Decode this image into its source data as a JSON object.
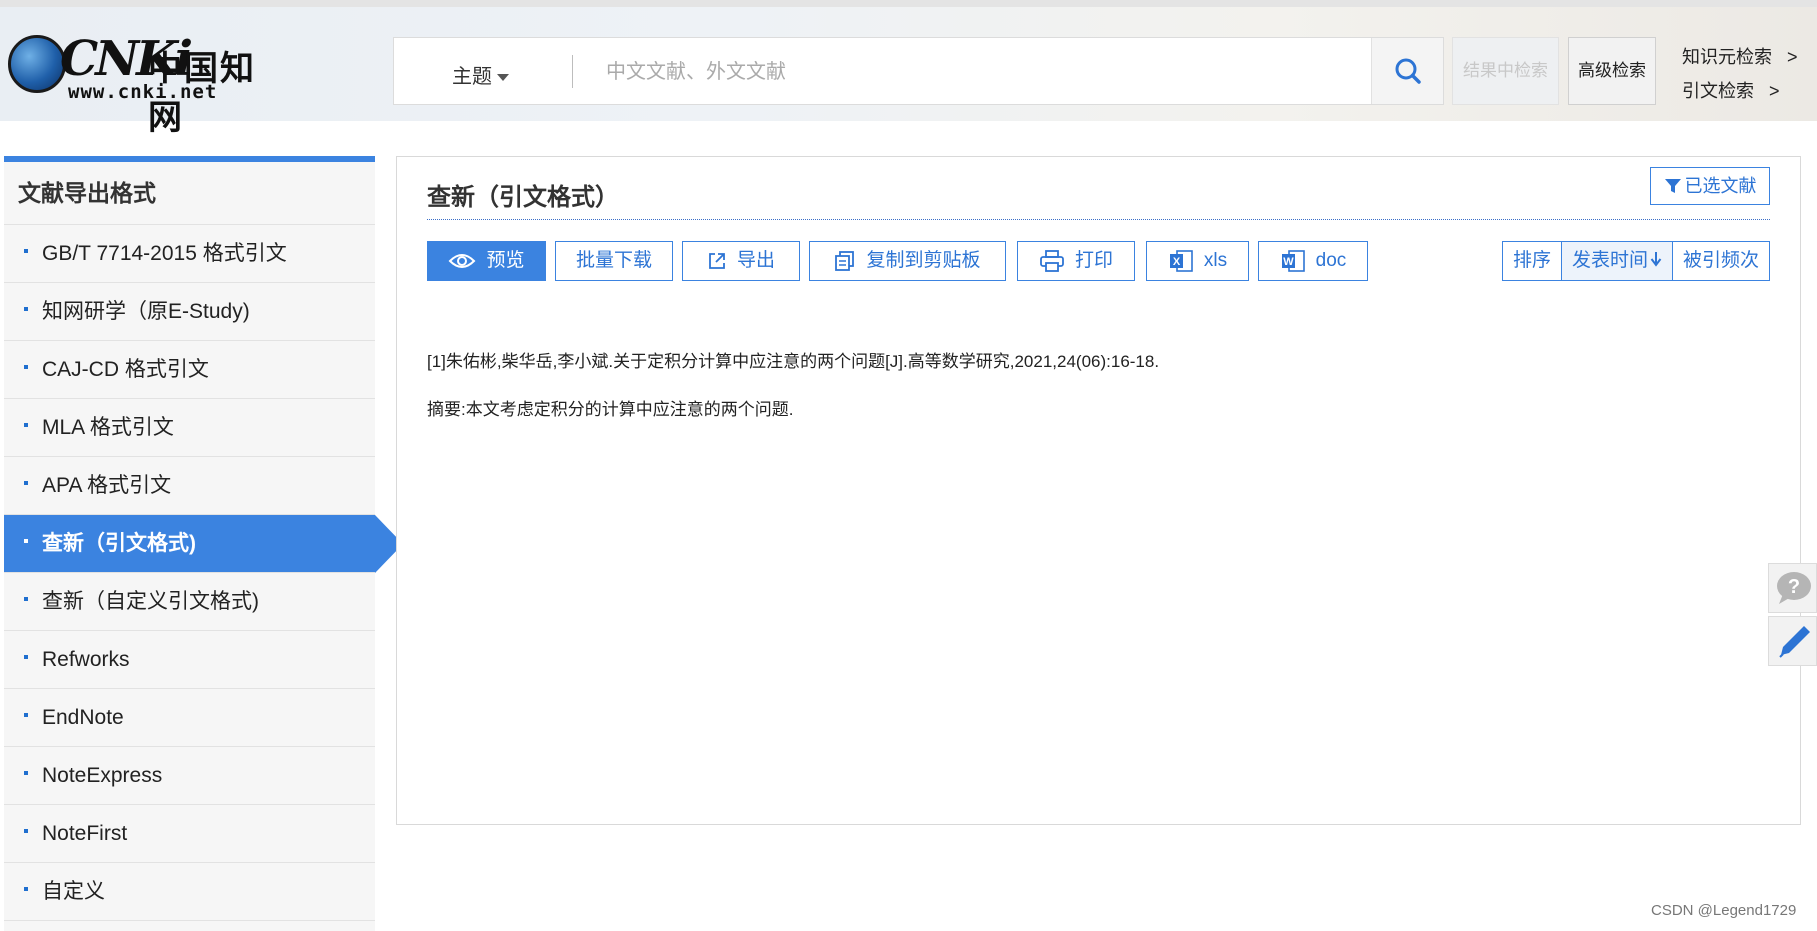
{
  "header": {
    "logo": {
      "brand": "CNKi",
      "cn_name": "中国知网",
      "url": "www.cnki.net"
    },
    "search": {
      "field_label": "主题",
      "placeholder": "中文文献、外文文献"
    },
    "result_search_label": "结果中检索",
    "advanced_search_label": "高级检索",
    "links": [
      {
        "label": "知识元检索",
        "arrow": ">"
      },
      {
        "label": "引文检索",
        "arrow": ">"
      }
    ]
  },
  "sidebar": {
    "title": "文献导出格式",
    "items": [
      {
        "label": "GB/T 7714-2015 格式引文",
        "active": false
      },
      {
        "label": "知网研学（原E-Study)",
        "active": false
      },
      {
        "label": "CAJ-CD 格式引文",
        "active": false
      },
      {
        "label": "MLA 格式引文",
        "active": false
      },
      {
        "label": "APA 格式引文",
        "active": false
      },
      {
        "label": "查新（引文格式)",
        "active": true
      },
      {
        "label": "查新（自定义引文格式)",
        "active": false
      },
      {
        "label": "Refworks",
        "active": false
      },
      {
        "label": "EndNote",
        "active": false
      },
      {
        "label": "NoteExpress",
        "active": false
      },
      {
        "label": "NoteFirst",
        "active": false
      },
      {
        "label": "自定义",
        "active": false
      }
    ]
  },
  "main": {
    "title": "查新（引文格式）",
    "selected_docs_label": "已选文献",
    "toolbar": {
      "preview": "预览",
      "batch_download": "批量下载",
      "export": "导出",
      "copy": "复制到剪贴板",
      "print": "打印",
      "xls": "xls",
      "doc": "doc"
    },
    "sort": {
      "label": "排序",
      "pub_time": "发表时间",
      "cited": "被引频次"
    },
    "citation": "[1]朱佑彬,柴华岳,李小斌.关于定积分计算中应注意的两个问题[J].高等数学研究,2021,24(06):16-18.",
    "abstract": "摘要:本文考虑定积分的计算中应注意的两个问题."
  },
  "watermark": "CSDN @Legend1729",
  "colors": {
    "accent": "#3b83e0",
    "link": "#2d74d4"
  }
}
